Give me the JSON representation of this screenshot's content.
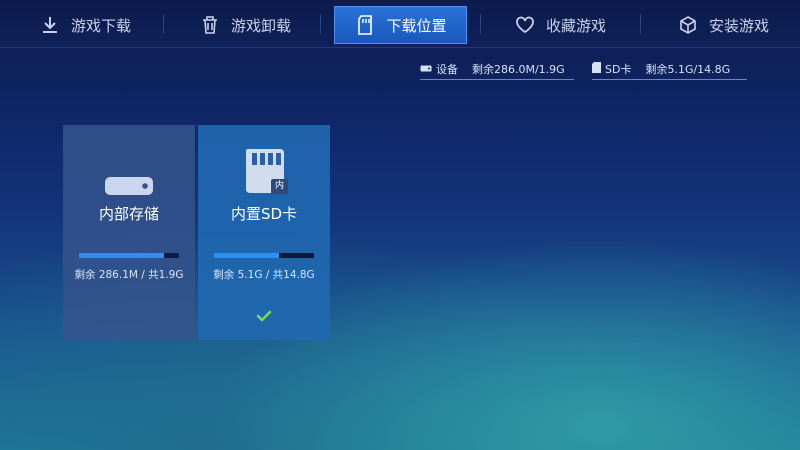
{
  "tabs": [
    {
      "label": "游戏下载",
      "icon": "download-icon",
      "active": false
    },
    {
      "label": "游戏卸载",
      "icon": "trash-icon",
      "active": false
    },
    {
      "label": "下载位置",
      "icon": "sd-card-icon",
      "active": true
    },
    {
      "label": "收藏游戏",
      "icon": "heart-icon",
      "active": false
    },
    {
      "label": "安装游戏",
      "icon": "box-icon",
      "active": false
    }
  ],
  "info": {
    "device": {
      "label": "设备",
      "value": "剩余286.0M/1.9G",
      "icon": "device-icon"
    },
    "sd": {
      "label": "SD卡",
      "value": "剩余5.1G/14.8G",
      "icon": "sd-card-icon"
    }
  },
  "cards": {
    "internal": {
      "title": "内部存储",
      "capacity": "剩余 286.1M / 共1.9G",
      "used_fraction": 0.85,
      "icon": "hard-drive-icon",
      "selected": false
    },
    "sd": {
      "title": "内置SD卡",
      "capacity": "剩余 5.1G / 共14.8G",
      "used_fraction": 0.65,
      "icon": "sd-card-icon",
      "badge": "内",
      "selected": true
    }
  },
  "colors": {
    "accent": "#1f6fd6",
    "check": "#7ed957"
  }
}
